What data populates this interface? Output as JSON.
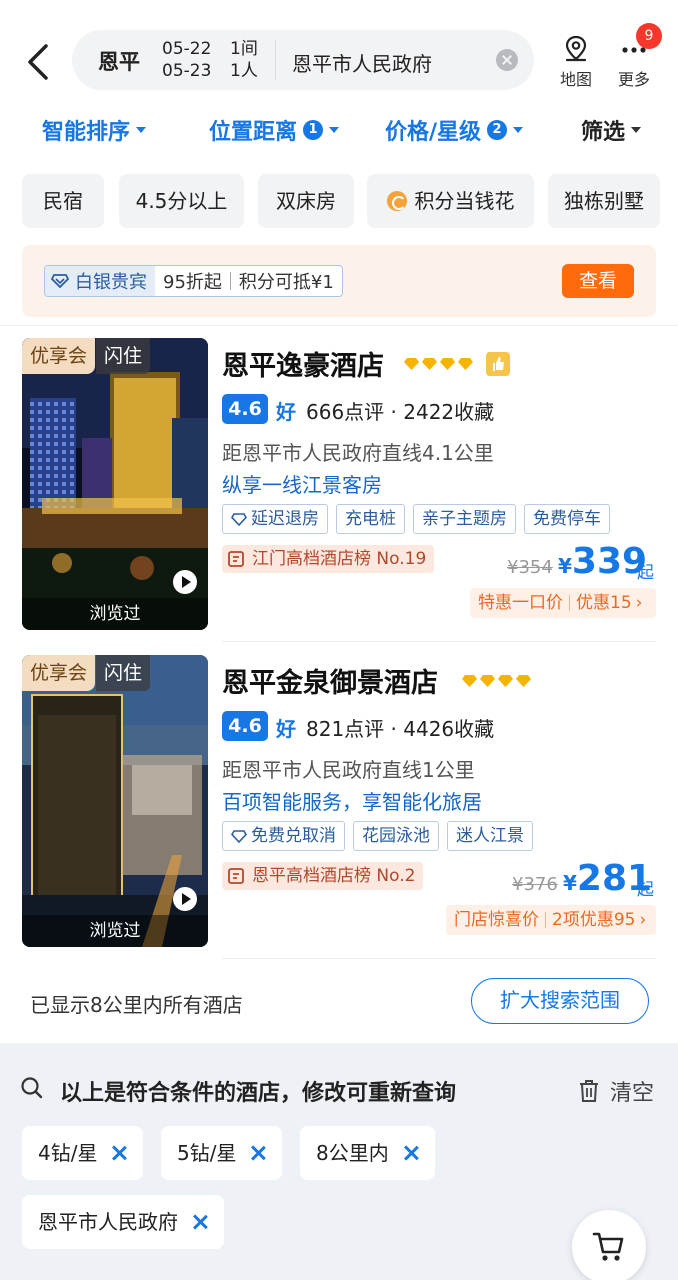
{
  "header": {
    "city": "恩平",
    "checkin": "05-22",
    "checkout": "05-23",
    "rooms": "1间",
    "guests": "1人",
    "query": "恩平市人民政府",
    "map_label": "地图",
    "more_label": "更多",
    "more_badge": "9"
  },
  "sort": {
    "smart": "智能排序",
    "distance": "位置距离",
    "distance_count": "1",
    "price": "价格/星级",
    "price_count": "2",
    "filter": "筛选"
  },
  "chips": [
    "民宿",
    "4.5分以上",
    "双床房",
    "积分当钱花",
    "独栋别墅"
  ],
  "member": {
    "level": "白银贵宾",
    "discount": "95折起",
    "points": "积分可抵¥1",
    "button": "查看"
  },
  "hotels": [
    {
      "tag_you": "优享会",
      "tag_shan": "闪住",
      "viewed": "浏览过",
      "name": "恩平逸豪酒店",
      "score": "4.6",
      "rating_word": "好",
      "reviews": "666点评 · 2422收藏",
      "distance": "距恩平市人民政府直线4.1公里",
      "slogan": "纵享一线江景客房",
      "features": [
        "延迟退房",
        "充电桩",
        "亲子主题房",
        "免费停车"
      ],
      "rank": "江门高档酒店榜 No.19",
      "original_price": "¥354",
      "currency": "¥",
      "price": "339",
      "price_suffix": "起",
      "promo_1": "特惠一口价",
      "promo_2": "优惠15",
      "stars": 4
    },
    {
      "tag_you": "优享会",
      "tag_shan": "闪住",
      "viewed": "浏览过",
      "name": "恩平金泉御景酒店",
      "score": "4.6",
      "rating_word": "好",
      "reviews": "821点评 · 4426收藏",
      "distance": "距恩平市人民政府直线1公里",
      "slogan": "百项智能服务，享智能化旅居",
      "features": [
        "免费兑取消",
        "花园泳池",
        "迷人江景"
      ],
      "rank": "恩平高档酒店榜 No.2",
      "original_price": "¥376",
      "currency": "¥",
      "price": "281",
      "price_suffix": "起",
      "promo_1": "门店惊喜价",
      "promo_2": "2项优惠95",
      "stars": 4
    }
  ],
  "footer": {
    "shown_text": "已显示8公里内所有酒店",
    "expand_button": "扩大搜索范围"
  },
  "panel": {
    "title": "以上是符合条件的酒店，修改可重新查询",
    "clear": "清空",
    "tags": [
      "4钻/星",
      "5钻/星",
      "8公里内",
      "恩平市人民政府"
    ]
  },
  "colors": {
    "accent": "#1677e5",
    "orange": "#ff6a0b",
    "badge_red": "#f5382b",
    "star_gold": "#f6b400"
  }
}
